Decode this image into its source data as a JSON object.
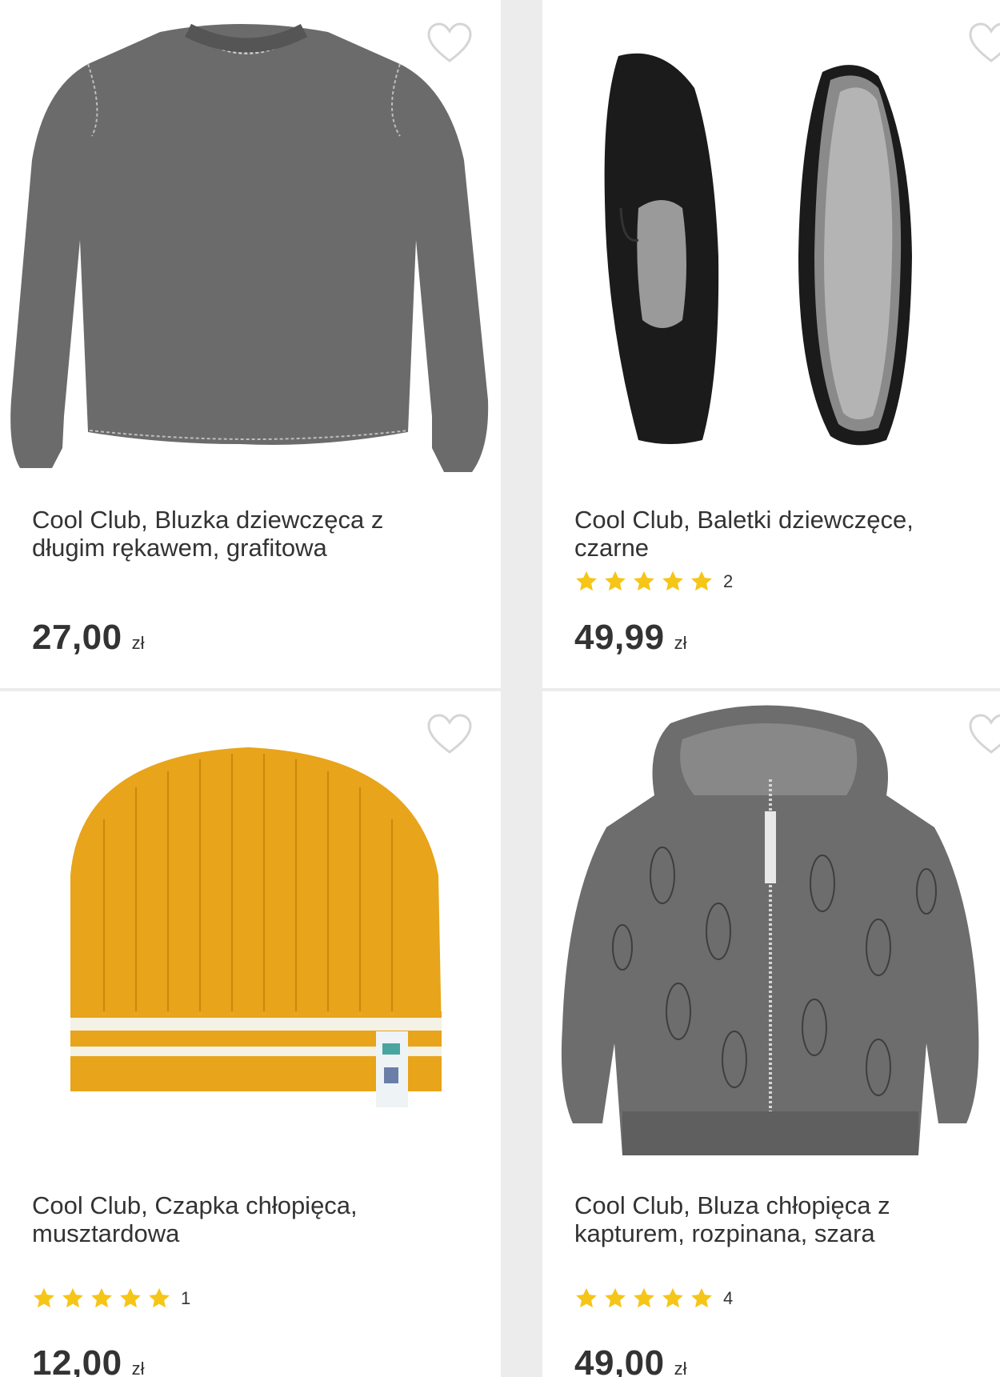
{
  "products": [
    {
      "name": "Cool Club, Bluzka dziewczęca z długim rękawem, grafitowa",
      "price": "27,00",
      "currency": "zł",
      "image": "grey-long-sleeve-top",
      "favorite_icon": "heart-icon"
    },
    {
      "name": "Cool Club, Baletki dziewczęce, czarne",
      "rating_stars": 5,
      "rating_count": "2",
      "price": "49,99",
      "currency": "zł",
      "image": "black-ballet-flats",
      "favorite_icon": "heart-icon"
    },
    {
      "name": "Cool Club, Czapka chłopięca, musztardowa",
      "rating_stars": 5,
      "rating_count": "1",
      "price": "12,00",
      "currency": "zł",
      "image": "mustard-knit-beanie",
      "favorite_icon": "heart-icon"
    },
    {
      "name": "Cool Club, Bluza chłopięca z kapturem, rozpinana, szara",
      "rating_stars": 5,
      "rating_count": "4",
      "price": "49,00",
      "currency": "zł",
      "image": "grey-zip-hoodie-rocket-print",
      "favorite_icon": "heart-icon"
    }
  ],
  "colors": {
    "star": "#f5c518",
    "heart_outline": "#d5d5d5",
    "text": "#333333",
    "background": "#ececec"
  }
}
